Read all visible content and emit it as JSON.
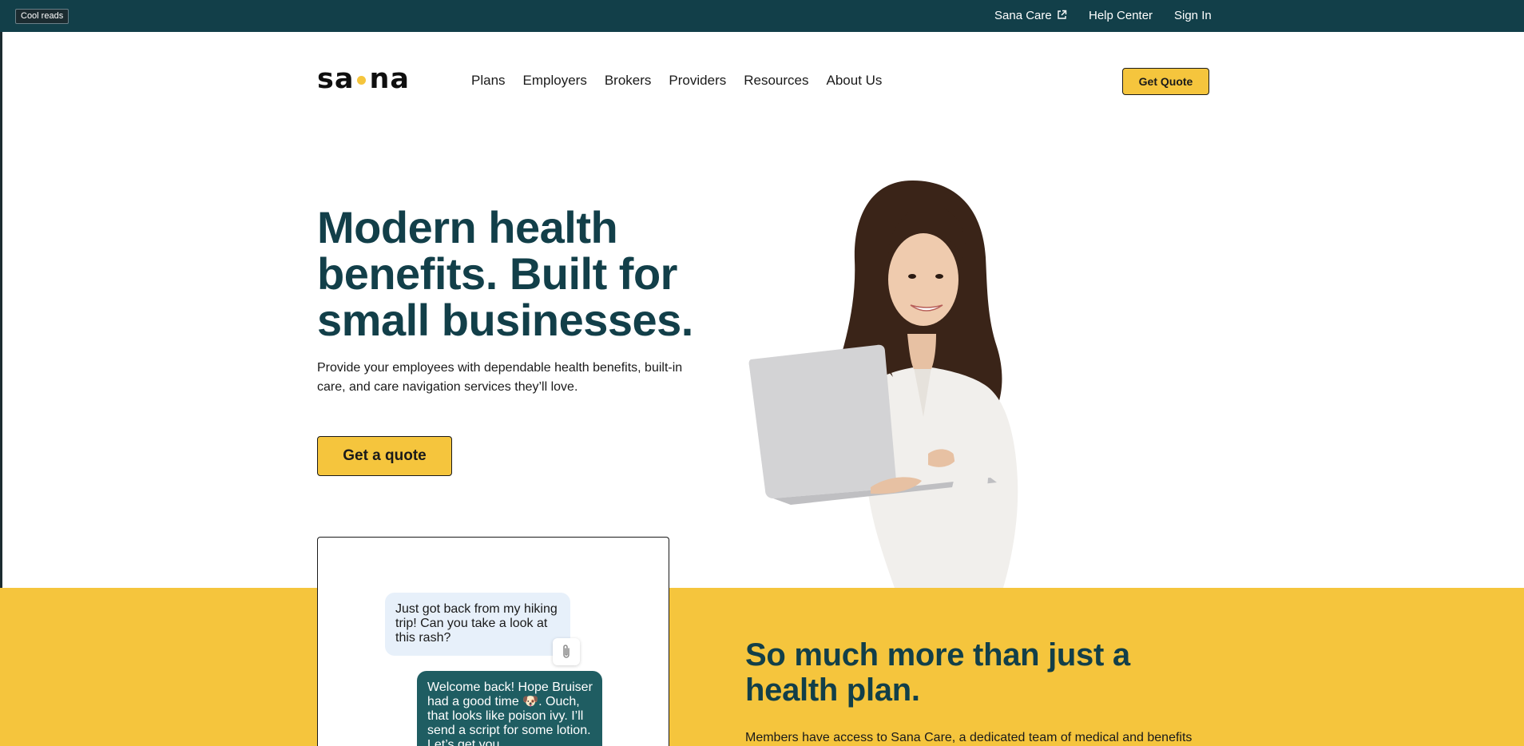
{
  "tooltip": "Cool reads",
  "utility_nav": {
    "sana_care": "Sana Care",
    "help_center": "Help Center",
    "sign_in": "Sign In"
  },
  "brand": {
    "logo_left": "sa",
    "logo_right": "na",
    "accent": "#f5c53d",
    "dark": "#123f49"
  },
  "nav": {
    "items": [
      "Plans",
      "Employers",
      "Brokers",
      "Providers",
      "Resources",
      "About Us"
    ],
    "cta": "Get Quote"
  },
  "hero": {
    "title": "Modern health benefits. Built for small businesses.",
    "subtitle": "Provide your employees with dependable health benefits, built-in care, and care navigation services they’ll love.",
    "cta": "Get a quote"
  },
  "chat": {
    "incoming": "Just got back from my hiking trip!  Can you take a look at this rash?",
    "outgoing": "Welcome back! Hope Bruiser had a good time 🐶. Ouch, that looks like poison ivy. I’ll send a script for some lotion. Let’s get you"
  },
  "band": {
    "title": "So much more than just a health plan.",
    "body": "Members have access to Sana Care, a dedicated team of medical and benefits"
  }
}
